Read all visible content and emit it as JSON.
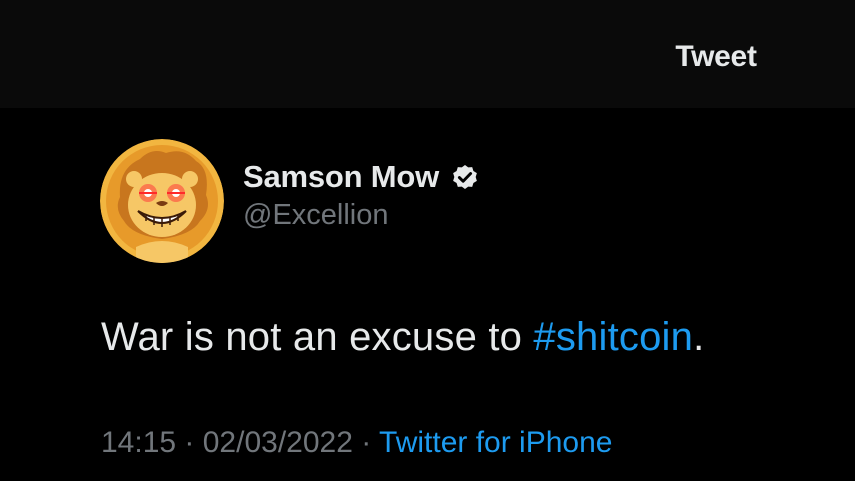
{
  "header": {
    "title": "Tweet"
  },
  "author": {
    "display_name": "Samson Mow",
    "handle": "@Excellion",
    "verified": true,
    "avatar_icon": "lion-laser-eyes-avatar"
  },
  "tweet": {
    "text_before": "War is not an excuse to ",
    "hashtag": "#shitcoin",
    "text_after": "."
  },
  "meta": {
    "time": "14:15",
    "separator_1": " · ",
    "date": "02/03/2022",
    "separator_2": " · ",
    "source": "Twitter for iPhone"
  },
  "colors": {
    "background": "#000000",
    "header_background": "#0a0a0a",
    "primary_text": "#e7e9ea",
    "secondary_text": "#71767b",
    "link": "#1d9bf0"
  }
}
